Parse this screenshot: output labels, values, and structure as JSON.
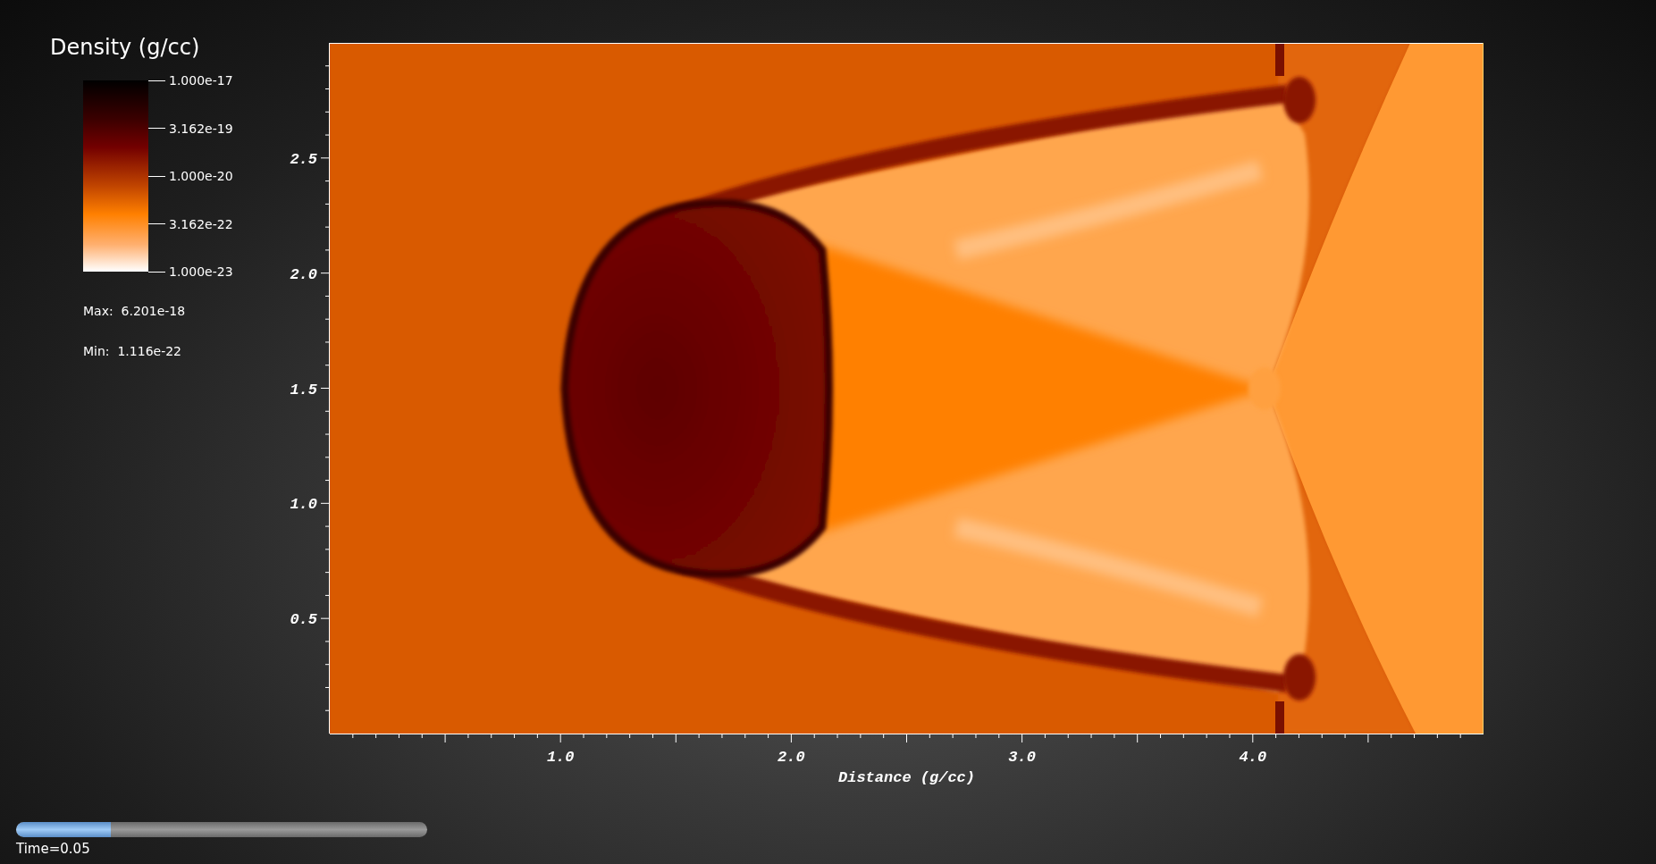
{
  "legend": {
    "title": "Density (g/cc)",
    "tick_labels": [
      "1.000e-17",
      "3.162e-19",
      "1.000e-20",
      "3.162e-22",
      "1.000e-23"
    ],
    "max_label": "Max:  6.201e-18",
    "min_label": "Min:  1.116e-22"
  },
  "plot": {
    "yticks": [
      "2.5",
      "2.0",
      "1.5",
      "1.0",
      "0.5"
    ],
    "xticks": [
      "1.0",
      "2.0",
      "3.0",
      "4.0"
    ],
    "xlabel": "Distance (g/cc)"
  },
  "time_slider": {
    "level": 0.23,
    "label": "Time=0.05"
  }
}
